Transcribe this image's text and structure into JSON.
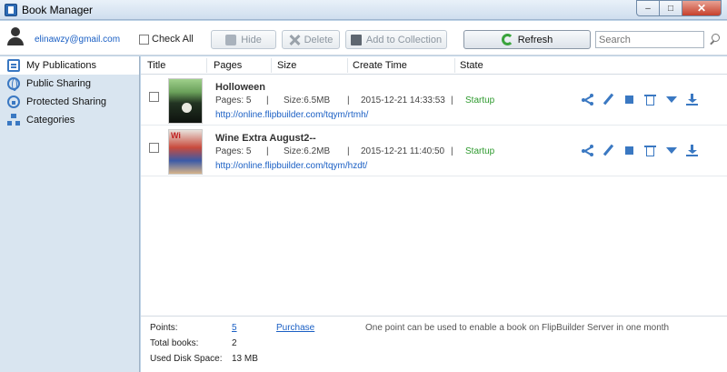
{
  "window": {
    "title": "Book Manager",
    "min_glyph": "–",
    "max_glyph": "□",
    "close_glyph": "✕"
  },
  "toolbar": {
    "email": "elinawzy@gmail.com",
    "check_all": "Check All",
    "hide": "Hide",
    "delete": "Delete",
    "add_to_collection": "Add to Collection",
    "refresh": "Refresh",
    "search_placeholder": "Search"
  },
  "sidebar": {
    "items": [
      {
        "label": "My Publications",
        "icon": "publications-icon"
      },
      {
        "label": "Public Sharing",
        "icon": "globe-icon"
      },
      {
        "label": "Protected Sharing",
        "icon": "lock-icon"
      },
      {
        "label": "Categories",
        "icon": "categories-icon"
      }
    ]
  },
  "columns": [
    "Title",
    "Pages",
    "Size",
    "Create Time",
    "State"
  ],
  "books": [
    {
      "title": "Holloween",
      "pages": "Pages: 5",
      "size": "Size:6.5MB",
      "sep": "|",
      "created": "2015-12-21 14:33:53",
      "state": "Startup",
      "url": "http://online.flipbuilder.com/tqym/rtmh/"
    },
    {
      "title": "Wine Extra August2--",
      "pages": "Pages: 5",
      "size": "Size:6.2MB",
      "sep": "|",
      "created": "2015-12-21 11:40:50",
      "state": "Startup",
      "url": "http://online.flipbuilder.com/tqym/hzdt/"
    }
  ],
  "footer": {
    "points_label": "Points:",
    "points_value": "5",
    "purchase": "Purchase",
    "note": "One point can be used to enable a book on FlipBuilder Server in one month",
    "total_books_label": "Total books:",
    "total_books_value": "2",
    "disk_label": "Used Disk Space:",
    "disk_value": "13 MB"
  },
  "colors": {
    "accent": "#3a78c2",
    "link": "#1a5fc4",
    "state_green": "#2e9a2e",
    "sidebar_bg": "#d9e5f0"
  }
}
